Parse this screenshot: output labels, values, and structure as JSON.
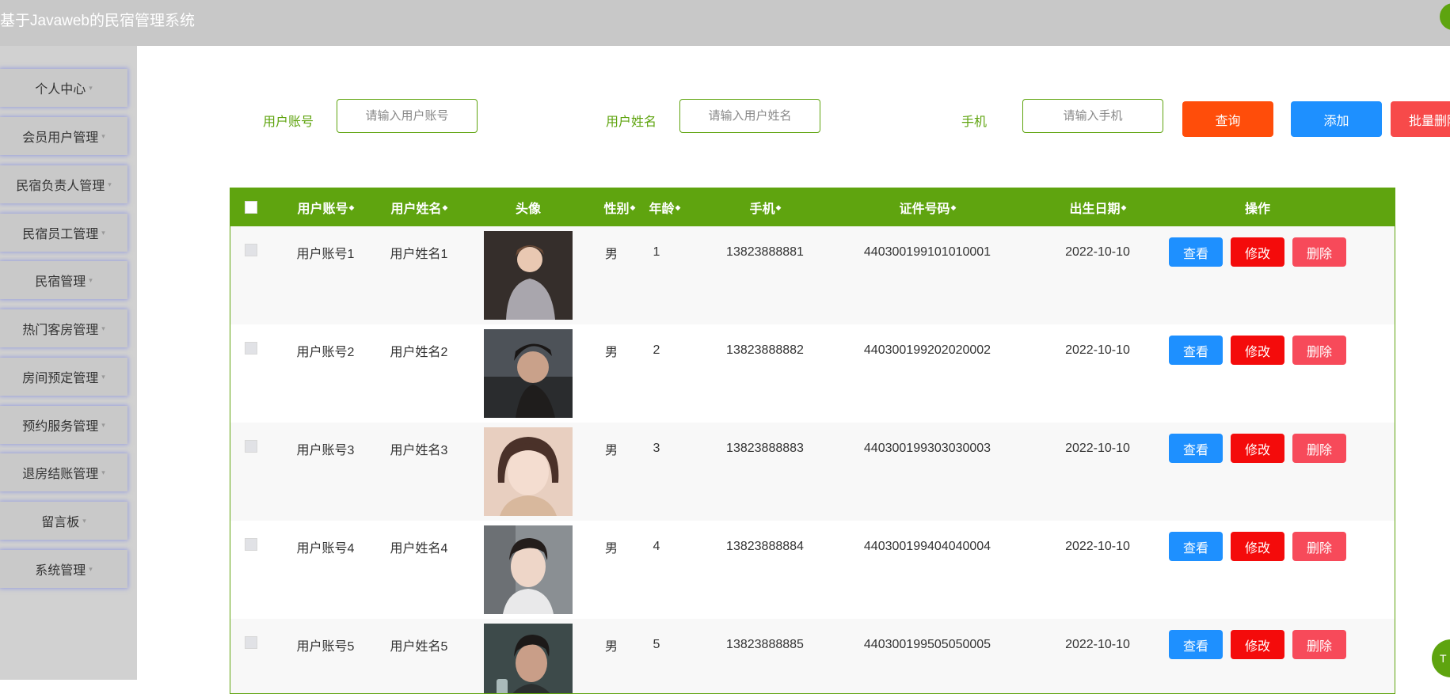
{
  "app": {
    "title": "基于Javaweb的民宿管理系统"
  },
  "sidebar": {
    "items": [
      {
        "label": "个人中心"
      },
      {
        "label": "会员用户管理"
      },
      {
        "label": "民宿负责人管理"
      },
      {
        "label": "民宿员工管理"
      },
      {
        "label": "民宿管理"
      },
      {
        "label": "热门客房管理"
      },
      {
        "label": "房间预定管理"
      },
      {
        "label": "预约服务管理"
      },
      {
        "label": "退房结账管理"
      },
      {
        "label": "留言板"
      },
      {
        "label": "系统管理"
      }
    ],
    "caret": "▾"
  },
  "search": {
    "account_label": "用户账号",
    "account_placeholder": "请输入用户账号",
    "name_label": "用户姓名",
    "name_placeholder": "请输入用户姓名",
    "phone_label": "手机",
    "phone_placeholder": "请输入手机",
    "query_button": "查询",
    "add_button": "添加",
    "batch_delete_button": "批量删除"
  },
  "table": {
    "columns": {
      "account": "用户账号",
      "name": "用户姓名",
      "avatar": "头像",
      "gender": "性别",
      "age": "年龄",
      "phone": "手机",
      "id_number": "证件号码",
      "birth_date": "出生日期",
      "actions": "操作"
    },
    "sort_icon": "◆",
    "rows": [
      {
        "account": "用户账号1",
        "name": "用户姓名1",
        "gender": "男",
        "age": "1",
        "phone": "13823888881",
        "id_number": "440300199101010001",
        "birth_date": "2022-10-10"
      },
      {
        "account": "用户账号2",
        "name": "用户姓名2",
        "gender": "男",
        "age": "2",
        "phone": "13823888882",
        "id_number": "440300199202020002",
        "birth_date": "2022-10-10"
      },
      {
        "account": "用户账号3",
        "name": "用户姓名3",
        "gender": "男",
        "age": "3",
        "phone": "13823888883",
        "id_number": "440300199303030003",
        "birth_date": "2022-10-10"
      },
      {
        "account": "用户账号4",
        "name": "用户姓名4",
        "gender": "男",
        "age": "4",
        "phone": "13823888884",
        "id_number": "440300199404040004",
        "birth_date": "2022-10-10"
      },
      {
        "account": "用户账号5",
        "name": "用户姓名5",
        "gender": "男",
        "age": "5",
        "phone": "13823888885",
        "id_number": "440300199505050005",
        "birth_date": "2022-10-10"
      }
    ],
    "row_actions": {
      "view": "查看",
      "edit": "修改",
      "delete": "删除"
    }
  },
  "fab": {
    "label": "T"
  },
  "colors": {
    "accent": "#5fa40f",
    "query": "#ff4d0a",
    "add": "#1e90ff",
    "danger": "#f74a5a",
    "edit": "#f40b0b"
  }
}
